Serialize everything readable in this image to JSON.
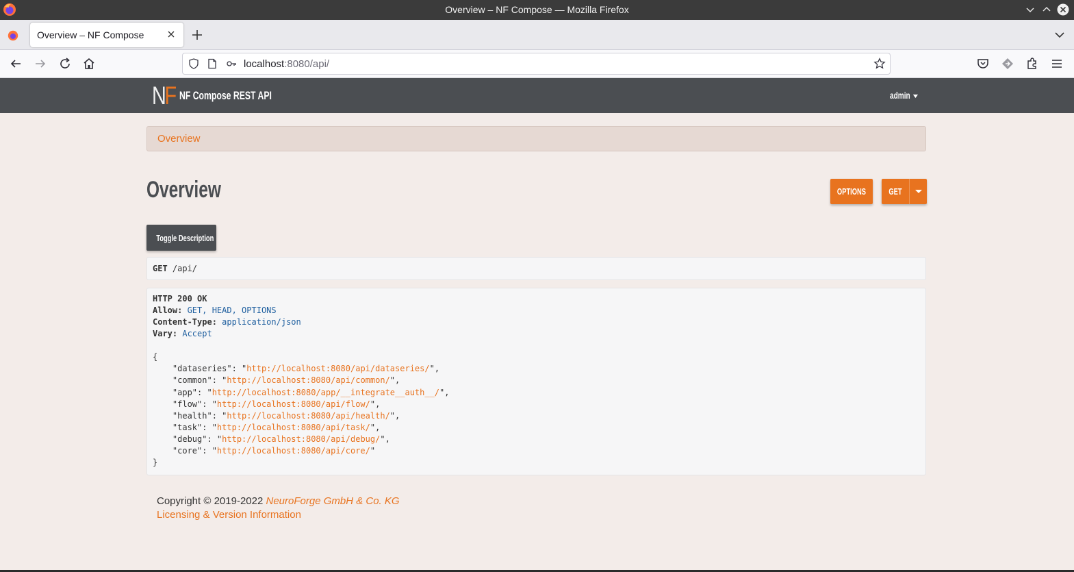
{
  "window": {
    "title": "Overview – NF Compose — Mozilla Firefox"
  },
  "browser": {
    "tab_title": "Overview – NF Compose",
    "url_host": "localhost",
    "url_rest": ":8080/api/"
  },
  "app": {
    "logo_n": "N",
    "logo_f": "F",
    "brand": "NF Compose REST API",
    "user": "admin"
  },
  "breadcrumb": {
    "current": "Overview"
  },
  "page": {
    "title": "Overview",
    "options_label": "OPTIONS",
    "get_label": "GET",
    "toggle_label": "Toggle Description"
  },
  "request": {
    "method": "GET",
    "path": " /api/"
  },
  "response": {
    "status": "HTTP 200 OK",
    "headers": [
      {
        "key": "Allow:",
        "value": " GET, HEAD, OPTIONS"
      },
      {
        "key": "Content-Type:",
        "value": " application/json"
      },
      {
        "key": "Vary:",
        "value": " Accept"
      }
    ],
    "open_brace": "{",
    "close_brace": "}",
    "body": [
      {
        "key": "    \"dataseries\": \"",
        "url": "http://localhost:8080/api/dataseries/",
        "end": "\","
      },
      {
        "key": "    \"common\": \"",
        "url": "http://localhost:8080/api/common/",
        "end": "\","
      },
      {
        "key": "    \"app\": \"",
        "url": "http://localhost:8080/app/__integrate__auth__/",
        "end": "\","
      },
      {
        "key": "    \"flow\": \"",
        "url": "http://localhost:8080/api/flow/",
        "end": "\","
      },
      {
        "key": "    \"health\": \"",
        "url": "http://localhost:8080/api/health/",
        "end": "\","
      },
      {
        "key": "    \"task\": \"",
        "url": "http://localhost:8080/api/task/",
        "end": "\","
      },
      {
        "key": "    \"debug\": \"",
        "url": "http://localhost:8080/api/debug/",
        "end": "\","
      },
      {
        "key": "    \"core\": \"",
        "url": "http://localhost:8080/api/core/",
        "end": "\""
      }
    ]
  },
  "footer": {
    "copyright": "Copyright © 2019-2022 ",
    "company": "NeuroForge GmbH & Co. KG",
    "licensing": "Licensing & Version Information"
  },
  "colors": {
    "accent": "#e8731f",
    "navbar": "#4b4e52",
    "background": "#f3ece9"
  }
}
